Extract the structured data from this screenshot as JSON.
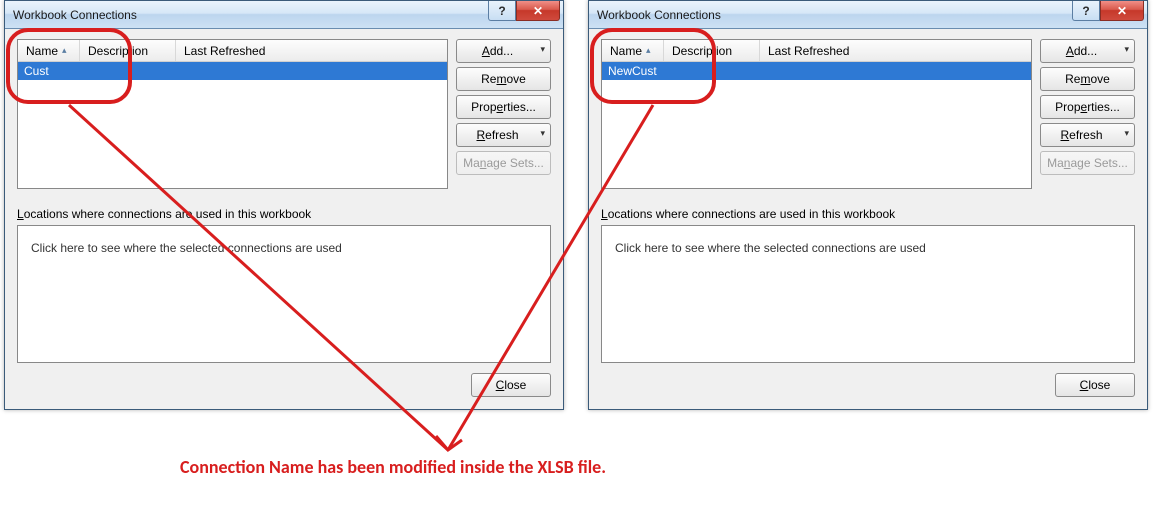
{
  "dialogs": [
    {
      "title": "Workbook Connections",
      "columns": {
        "name": "Name",
        "description": "Description",
        "lastRefreshed": "Last Refreshed"
      },
      "row_name": "Cust",
      "buttons": {
        "add": "Add...",
        "remove": "Remove",
        "properties": "Properties...",
        "refresh": "Refresh",
        "manage": "Manage Sets..."
      },
      "locations_label_pre": "L",
      "locations_label_rest": "ocations where connections are used in this workbook",
      "locations_hint": "Click here to see where the selected connections are used",
      "close_label": "Close"
    },
    {
      "title": "Workbook Connections",
      "columns": {
        "name": "Name",
        "description": "Description",
        "lastRefreshed": "Last Refreshed"
      },
      "row_name": "NewCust",
      "buttons": {
        "add": "Add...",
        "remove": "Remove",
        "properties": "Properties...",
        "refresh": "Refresh",
        "manage": "Manage Sets..."
      },
      "locations_label_pre": "L",
      "locations_label_rest": "ocations where connections are used in this workbook",
      "locations_hint": "Click here to see where the selected connections are used",
      "close_label": "Close"
    }
  ],
  "annotation_text": "Connection Name has been modified inside the XLSB file.",
  "help_glyph": "?",
  "close_glyph": "✕"
}
